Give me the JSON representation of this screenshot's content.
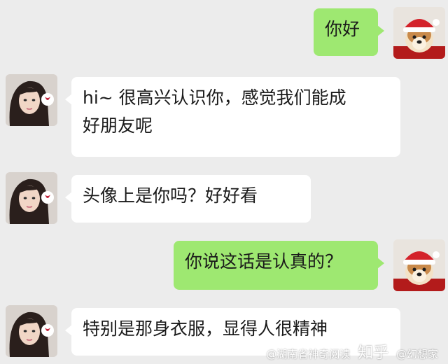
{
  "messages": [
    {
      "side": "out",
      "text": "你好",
      "avatar": "dog-santa-hat-avatar"
    },
    {
      "side": "in",
      "text_line1": "hi~ 很高兴认识你，感觉我们能成",
      "text_line2": "好朋友呢",
      "avatar": "girl-avatar"
    },
    {
      "side": "in",
      "text": "头像上是你吗？好好看",
      "avatar": "girl-avatar"
    },
    {
      "side": "out",
      "text": "你说这话是认真的？",
      "avatar": "dog-santa-hat-avatar"
    },
    {
      "side": "in",
      "text": "特别是那身衣服，显得人很精神",
      "avatar": "girl-avatar"
    }
  ],
  "watermark": {
    "prefix": "@湖南省神奇阅读",
    "brand": "知乎",
    "suffix": "@幻想家"
  },
  "colors": {
    "background": "#ececec",
    "incoming_bubble": "#ffffff",
    "outgoing_bubble": "#9ee871"
  }
}
